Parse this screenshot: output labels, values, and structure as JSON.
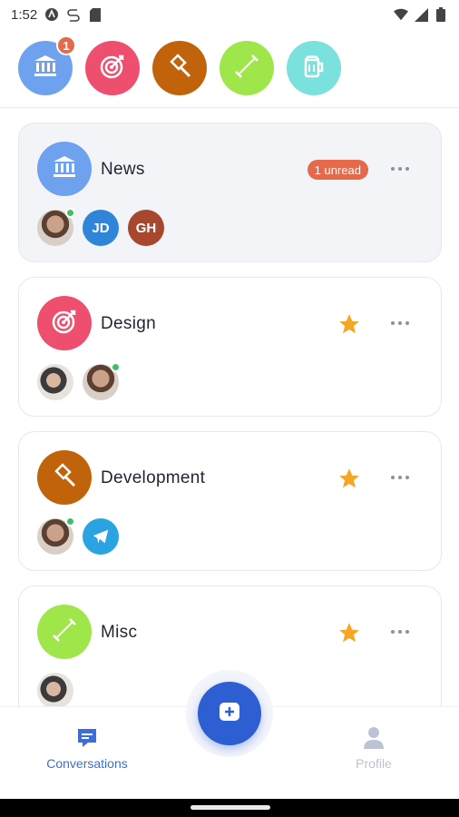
{
  "status": {
    "time": "1:52"
  },
  "rail": [
    {
      "name": "News",
      "color": "#6fa2ee",
      "icon": "bank-icon",
      "badge": "1"
    },
    {
      "name": "Design",
      "color": "#ef4f6f",
      "icon": "target-icon"
    },
    {
      "name": "Development",
      "color": "#c0630b",
      "icon": "hammer-icon"
    },
    {
      "name": "Misc",
      "color": "#9ee64a",
      "icon": "dumbbell-icon"
    },
    {
      "name": "Beer",
      "color": "#7ae1dd",
      "icon": "beer-icon"
    }
  ],
  "cards": [
    {
      "title": "News",
      "color": "#6fa2ee",
      "icon": "bank-icon",
      "unread": "1 unread",
      "members": [
        "photo-man",
        "JD",
        "GH"
      ]
    },
    {
      "title": "Design",
      "color": "#ef4f6f",
      "icon": "target-icon",
      "starred": true,
      "members": [
        "photo-woman",
        "photo-man"
      ]
    },
    {
      "title": "Development",
      "color": "#c0630b",
      "icon": "hammer-icon",
      "starred": true,
      "members": [
        "photo-man",
        "telegram-icon"
      ]
    },
    {
      "title": "Misc",
      "color": "#9ee64a",
      "icon": "dumbbell-icon",
      "starred": true,
      "members": [
        "photo-woman"
      ]
    }
  ],
  "member_colors": {
    "JD": "#2f86d8",
    "GH": "#a6472e"
  },
  "nav": {
    "conversations": "Conversations",
    "profile": "Profile"
  },
  "colors": {
    "accent": "#2d5fd3",
    "unread": "#e46a4b",
    "star": "#f5a623"
  }
}
